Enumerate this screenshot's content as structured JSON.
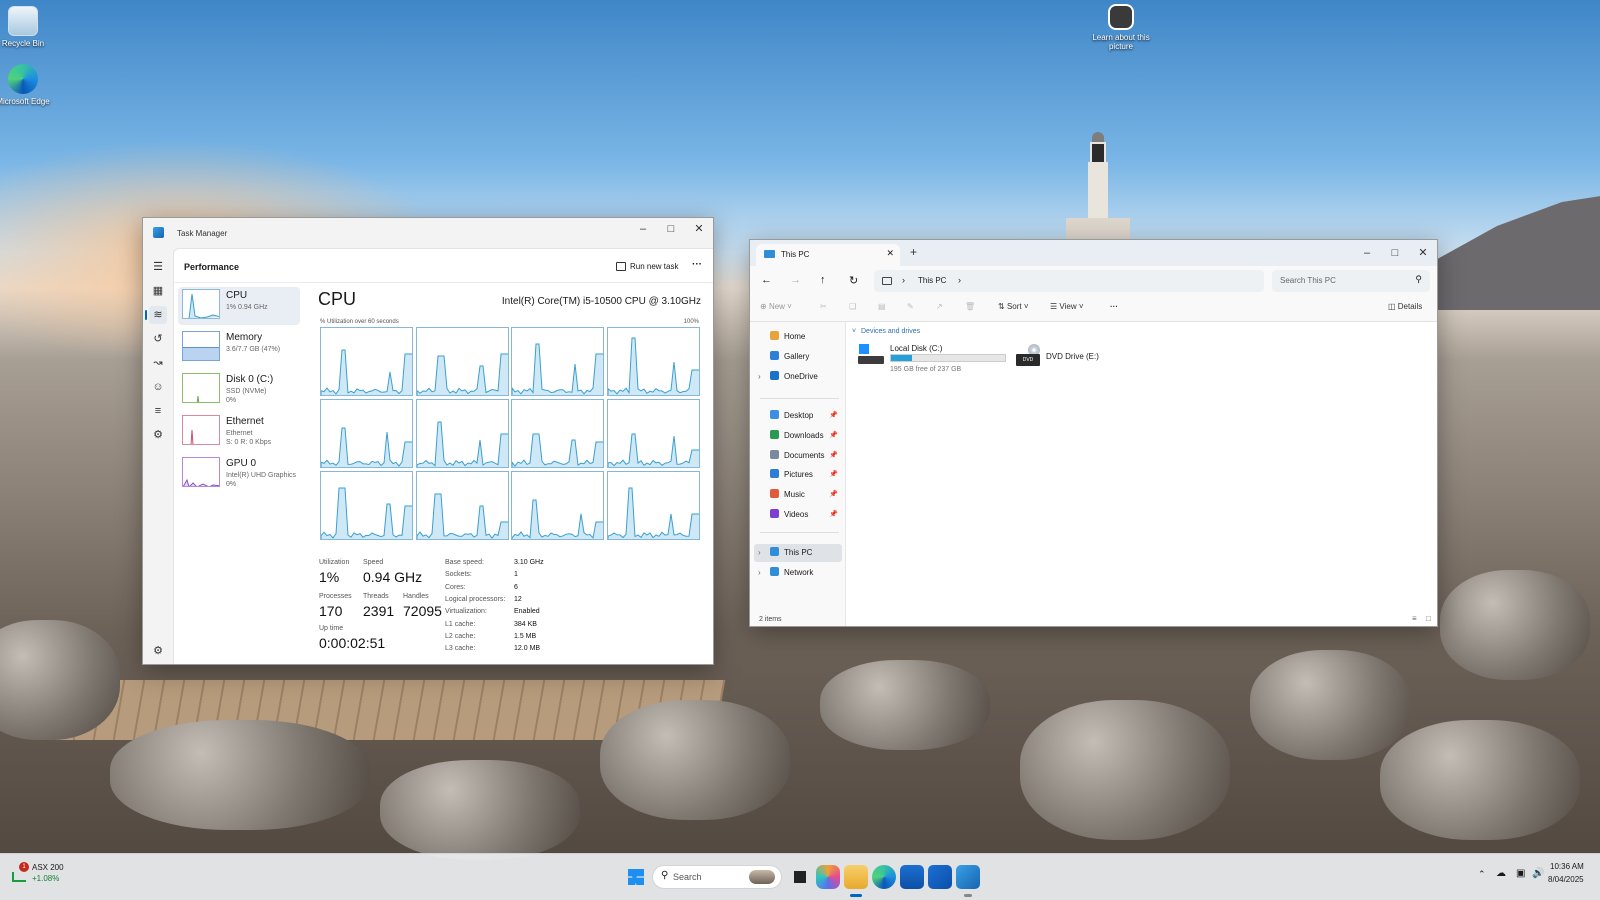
{
  "desktop": {
    "icons": [
      {
        "label": "Recycle Bin",
        "icon": "recycle-bin-icon"
      },
      {
        "label": "Microsoft Edge",
        "icon": "edge-icon"
      },
      {
        "label": "Learn about this picture",
        "icon": "camera-icon"
      }
    ]
  },
  "task_manager": {
    "title": "Task Manager",
    "section": "Performance",
    "run_new_task": "Run new task",
    "more": "···",
    "resources": [
      {
        "name": "CPU",
        "sub": "1% 0.94 GHz"
      },
      {
        "name": "Memory",
        "sub": "3.6/7.7 GB (47%)"
      },
      {
        "name": "Disk 0 (C:)",
        "sub": "SSD (NVMe)",
        "sub2": "0%"
      },
      {
        "name": "Ethernet",
        "sub": "Ethernet",
        "sub2": "S: 0 R: 0 Kbps"
      },
      {
        "name": "GPU 0",
        "sub": "Intel(R) UHD Graphics ...",
        "sub2": "0%"
      }
    ],
    "cpu": {
      "heading": "CPU",
      "model": "Intel(R) Core(TM) i5-10500 CPU @ 3.10GHz",
      "graph_caption": "% Utilization over 60 seconds",
      "graph_max": "100%",
      "stats": {
        "utilization_label": "Utilization",
        "utilization": "1%",
        "speed_label": "Speed",
        "speed": "0.94 GHz",
        "processes_label": "Processes",
        "processes": "170",
        "threads_label": "Threads",
        "threads": "2391",
        "handles_label": "Handles",
        "handles": "72095",
        "uptime_label": "Up time",
        "uptime": "0:00:02:51"
      },
      "specs": [
        {
          "key": "Base speed:",
          "value": "3.10 GHz"
        },
        {
          "key": "Sockets:",
          "value": "1"
        },
        {
          "key": "Cores:",
          "value": "6"
        },
        {
          "key": "Logical processors:",
          "value": "12"
        },
        {
          "key": "Virtualization:",
          "value": "Enabled"
        },
        {
          "key": "L1 cache:",
          "value": "384 KB"
        },
        {
          "key": "L2 cache:",
          "value": "1.5 MB"
        },
        {
          "key": "L3 cache:",
          "value": "12.0 MB"
        }
      ]
    }
  },
  "explorer": {
    "tab_title": "This PC",
    "breadcrumb": "This PC",
    "search_placeholder": "Search This PC",
    "commands": {
      "new": "New",
      "sort": "Sort",
      "view": "View",
      "more": "···",
      "details": "Details"
    },
    "nav": [
      {
        "label": "Home",
        "color": "#e8a33b"
      },
      {
        "label": "Gallery",
        "color": "#2f7fd9"
      },
      {
        "label": "OneDrive",
        "color": "#1a73c9"
      },
      {
        "label": "Desktop",
        "color": "#3b8ee3",
        "pinned": true
      },
      {
        "label": "Downloads",
        "color": "#2a9a53",
        "pinned": true
      },
      {
        "label": "Documents",
        "color": "#7a8a9c",
        "pinned": true
      },
      {
        "label": "Pictures",
        "color": "#2d7cd6",
        "pinned": true
      },
      {
        "label": "Music",
        "color": "#e05b3c",
        "pinned": true
      },
      {
        "label": "Videos",
        "color": "#7b3fd1",
        "pinned": true
      },
      {
        "label": "This PC",
        "color": "#2e8fd8"
      },
      {
        "label": "Network",
        "color": "#2e8fd8"
      }
    ],
    "group": "Devices and drives",
    "drives": [
      {
        "name": "Local Disk (C:)",
        "free": "195 GB free of 237 GB",
        "used_fraction": 0.18
      },
      {
        "name": "DVD Drive (E:)"
      }
    ],
    "status": "2 items"
  },
  "taskbar": {
    "ticker_name": "ASX 200",
    "ticker_change": "+1.08%",
    "ticker_badge": "1",
    "search": "Search",
    "time": "10:36 AM",
    "date": "8/04/2025"
  },
  "colors": {
    "cpu_graph": "#3a9fd1",
    "cpu_fill": "#cfe8f5",
    "accent": "#0067c0"
  }
}
